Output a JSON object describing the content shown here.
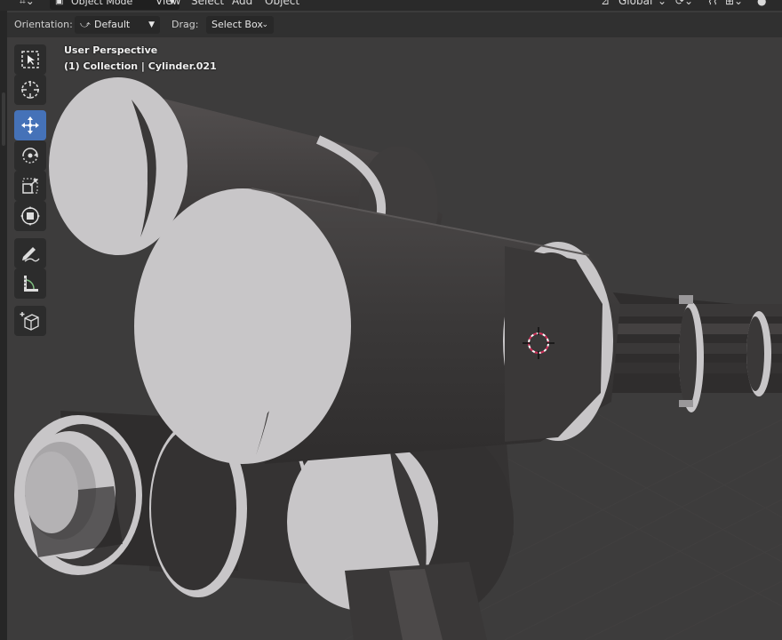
{
  "menu": {
    "mode_dropdown": "Object Mode",
    "items": [
      "View",
      "Select",
      "Add",
      "Object"
    ],
    "transform_orientation": "Global"
  },
  "header": {
    "orientation_label": "Orientation:",
    "orientation_value": "Default",
    "drag_label": "Drag:",
    "drag_value": "Select Box"
  },
  "viewport": {
    "perspective": "User Perspective",
    "collection": "(1) Collection | Cylinder.021"
  },
  "toolbar": {
    "tools": [
      {
        "icon": "select-box-icon",
        "active": false
      },
      {
        "icon": "cursor-icon",
        "active": false
      },
      {
        "icon": "move-icon",
        "active": true
      },
      {
        "icon": "rotate-icon",
        "active": false
      },
      {
        "icon": "scale-icon",
        "active": false
      },
      {
        "icon": "transform-icon",
        "active": false
      },
      {
        "icon": "annotate-icon",
        "active": false
      },
      {
        "icon": "measure-icon",
        "active": false
      },
      {
        "icon": "add-cube-icon",
        "active": false
      }
    ]
  },
  "colors": {
    "active_tool": "#4572b8",
    "viewport_bg": "#3d3c3c",
    "mesh_dark": "#3a3838",
    "mesh_light": "#c8c6c8"
  }
}
